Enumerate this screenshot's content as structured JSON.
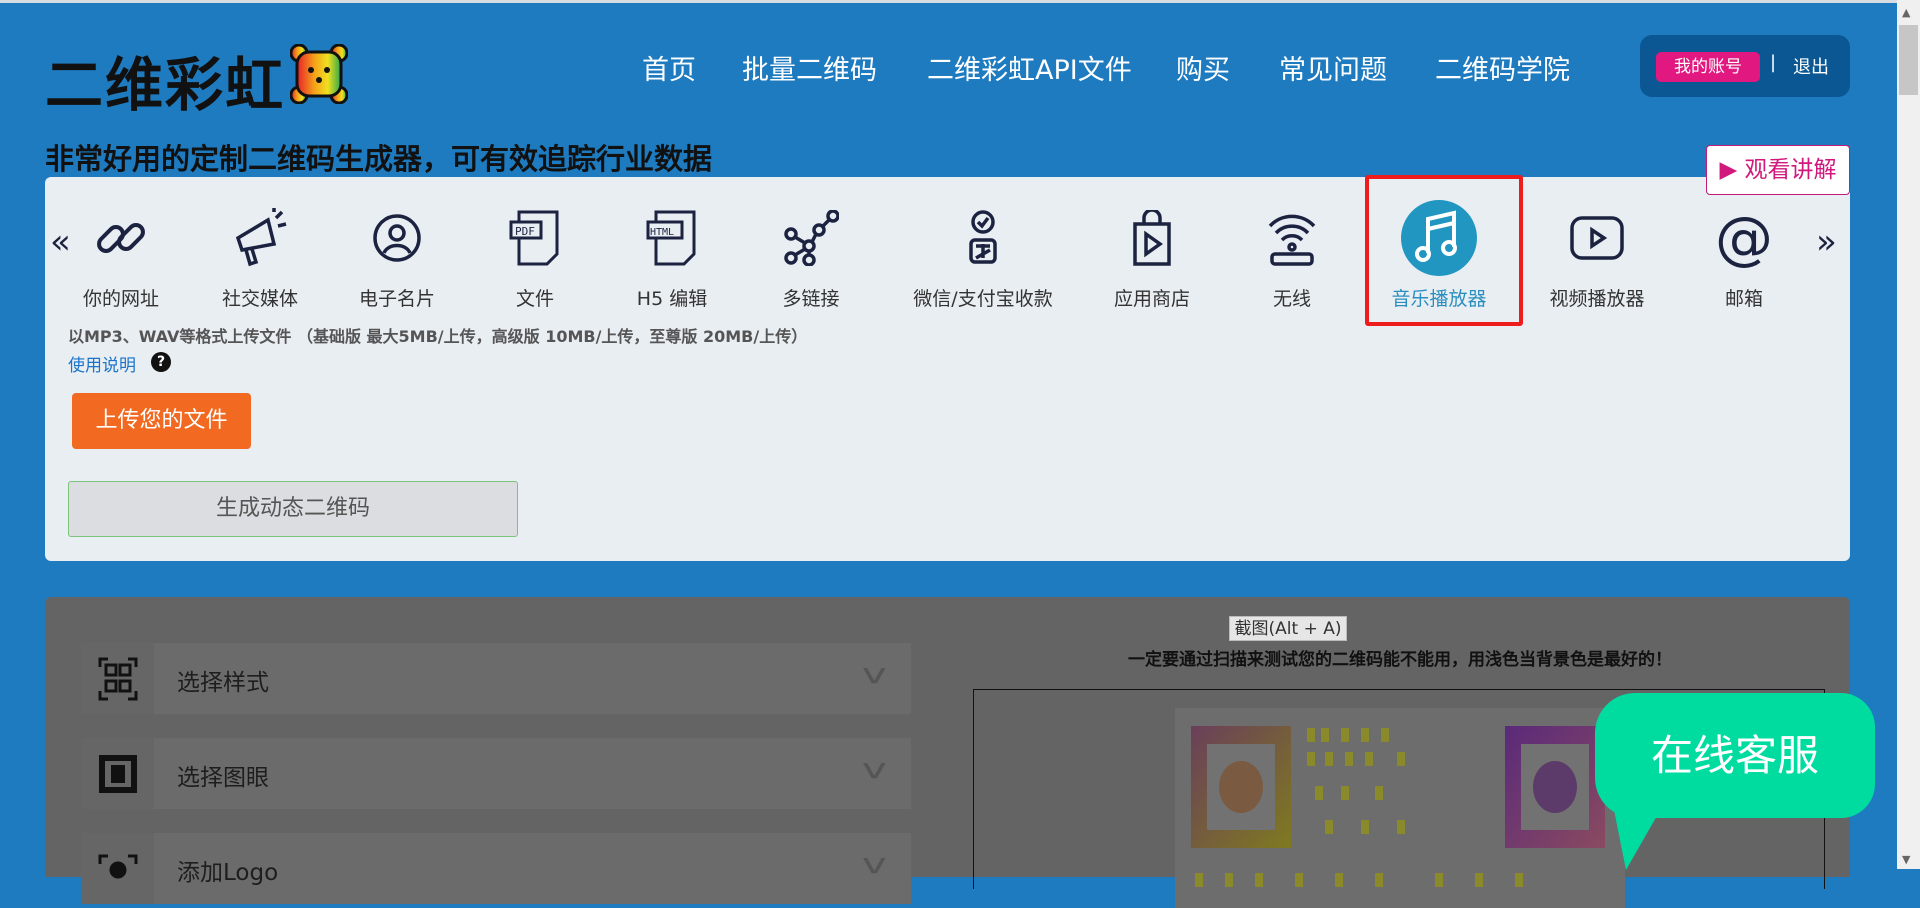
{
  "header": {
    "logo": "二维彩虹",
    "nav": [
      "首页",
      "批量二维码",
      "二维彩虹API文件",
      "购买",
      "常见问题",
      "二维码学院"
    ],
    "account": "我的账号",
    "separator": "|",
    "logout": "退出"
  },
  "subtitle": "非常好用的定制二维码生成器，可有效追踪行业数据",
  "watch_button": "▶ 观看讲解",
  "tools": [
    {
      "label": "你的网址",
      "icon": "link-icon"
    },
    {
      "label": "社交媒体",
      "icon": "megaphone-icon"
    },
    {
      "label": "电子名片",
      "icon": "user-circle-icon"
    },
    {
      "label": "文件",
      "icon": "pdf-file-icon"
    },
    {
      "label": "H5 编辑",
      "icon": "html-file-icon"
    },
    {
      "label": "多链接",
      "icon": "network-icon"
    },
    {
      "label": "微信/支付宝收款",
      "icon": "payment-icon"
    },
    {
      "label": "应用商店",
      "icon": "app-store-bag-icon"
    },
    {
      "label": "无线",
      "icon": "wifi-router-icon"
    },
    {
      "label": "音乐播放器",
      "icon": "music-note-icon",
      "selected": true
    },
    {
      "label": "视频播放器",
      "icon": "video-play-icon"
    },
    {
      "label": "邮箱",
      "icon": "at-sign-icon"
    }
  ],
  "nav_prev": "«",
  "nav_next": "»",
  "info": "以MP3、WAV等格式上传文件 （基础版 最大5MB/上传，高级版 10MB/上传，至尊版 20MB/上传）",
  "howto": "使用说明",
  "help": "?",
  "upload_button": "上传您的文件",
  "generate_button": "生成动态二维码",
  "options": [
    "选择样式",
    "选择图眼",
    "添加Logo"
  ],
  "snip_tooltip": "截图(Alt + A)",
  "hint": "一定要通过扫描来测试您的二维码能不能用，用浅色当背景色是最好的！",
  "chat": "在线客服",
  "colors": {
    "header_bg": "#1e7bc0",
    "accent_pink": "#e0187f",
    "upload_orange": "#f26a21",
    "chat_green": "#00dba0",
    "selected": "#2a8fbf"
  }
}
